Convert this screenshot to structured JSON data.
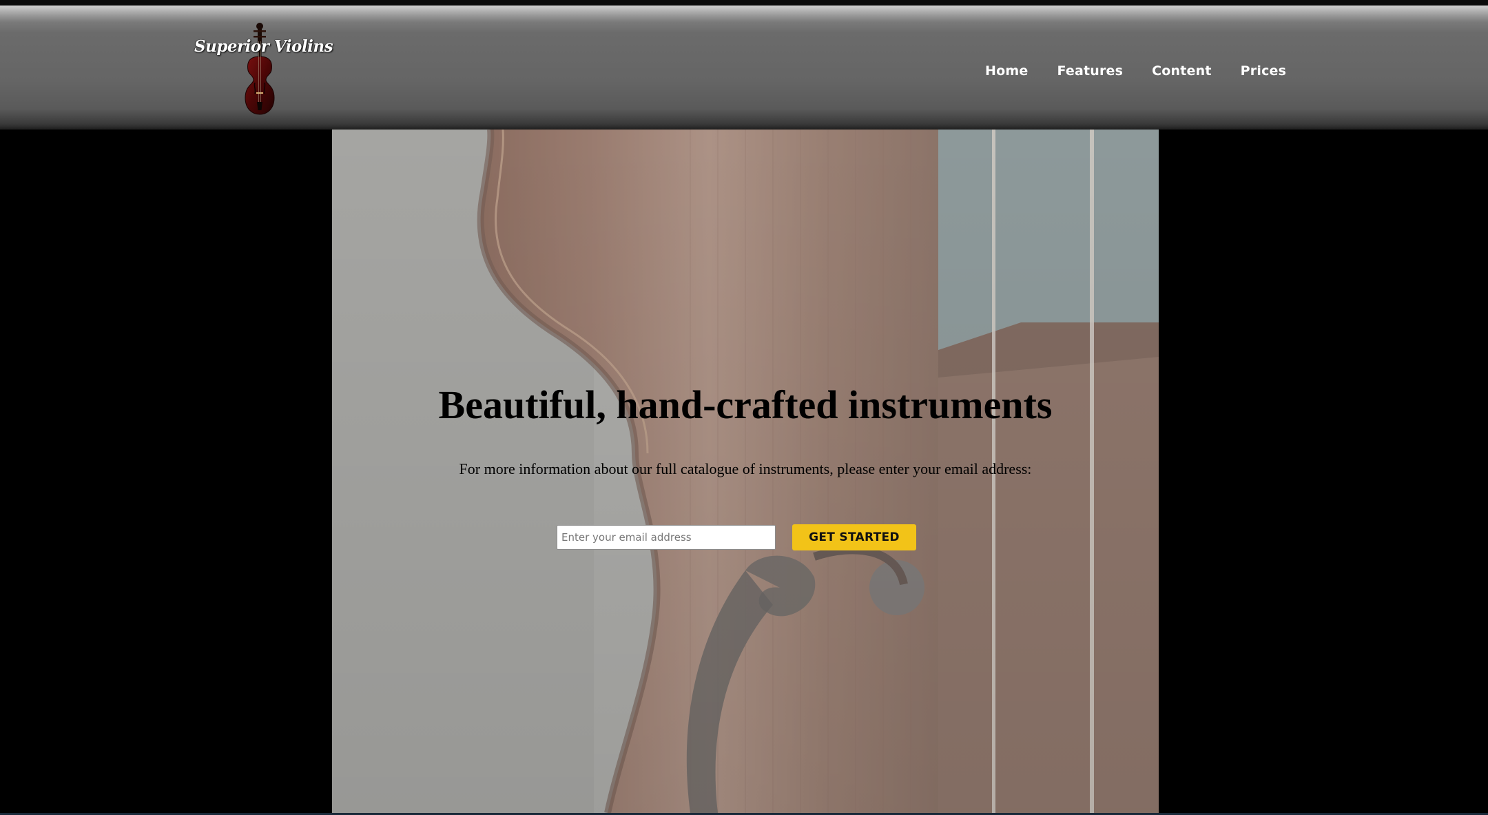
{
  "brand": {
    "name": "Superior Violins",
    "logo_icon": "violin-icon"
  },
  "nav": {
    "items": [
      {
        "label": "Home"
      },
      {
        "label": "Features"
      },
      {
        "label": "Content"
      },
      {
        "label": "Prices"
      }
    ]
  },
  "hero": {
    "title": "Beautiful, hand-crafted instruments",
    "text": "For more information about our full catalogue of instruments, please enter your email address:",
    "email_placeholder": "Enter your email address",
    "cta_label": "GET STARTED",
    "background_image": "violin-body-closeup"
  },
  "colors": {
    "page_background": "#000000",
    "header_gray": "#656565",
    "cta_yellow": "#f2c318",
    "hero_overlay": "#a4a4a1"
  }
}
